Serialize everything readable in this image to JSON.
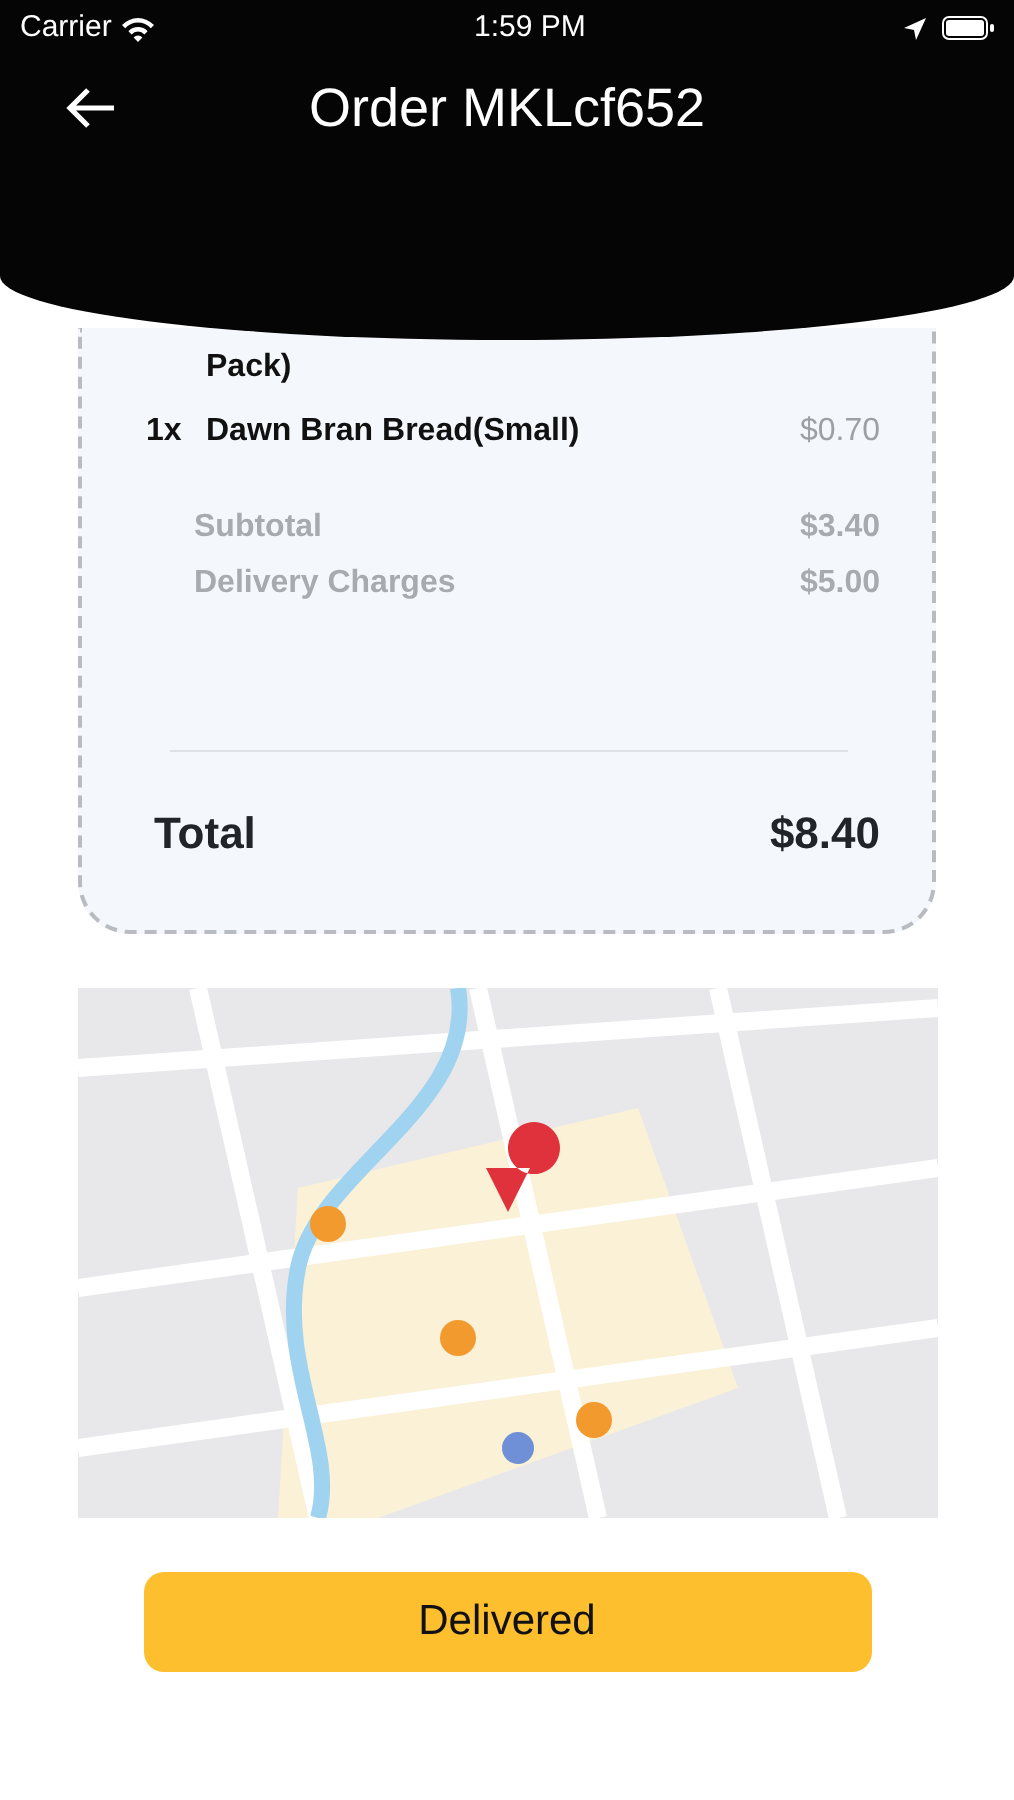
{
  "status_bar": {
    "carrier": "Carrier",
    "time": "1:59 PM"
  },
  "header": {
    "title": "Order MKLcf652"
  },
  "items": [
    {
      "name": "Pack)"
    },
    {
      "qty": "1x",
      "name": "Dawn Bran Bread(Small)",
      "price": "$0.70"
    }
  ],
  "charges": [
    {
      "label": "Subtotal",
      "value": "$3.40"
    },
    {
      "label": "Delivery Charges",
      "value": "$5.00"
    }
  ],
  "total": {
    "label": "Total",
    "value": "$8.40"
  },
  "status_button": {
    "label": "Delivered"
  }
}
